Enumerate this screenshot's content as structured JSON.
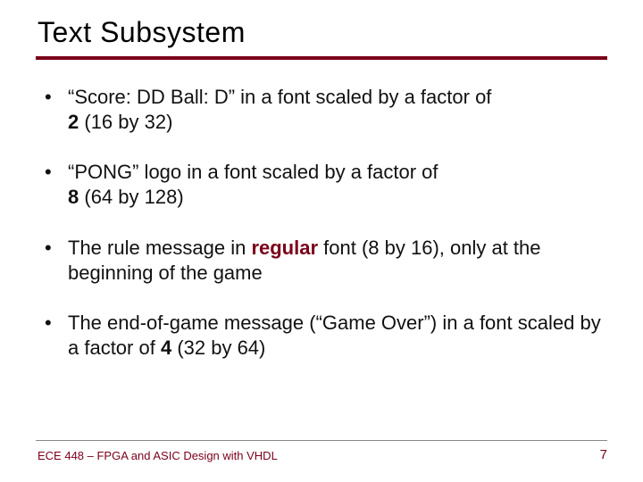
{
  "title": "Text Subsystem",
  "bullets": [
    {
      "pre": "“Score: DD  Ball:  D” in a font scaled by a factor of ",
      "strong": "2",
      "post": " (16 by 32)"
    },
    {
      "pre": "“PONG” logo in a font scaled by a factor of ",
      "strong": "8",
      "post": " (64 by 128)"
    },
    {
      "pre": "The rule message in ",
      "strong_maroon": "regular",
      "post": " font (8 by 16), only at the beginning of the game"
    },
    {
      "pre": "The end-of-game message (“Game Over”) in a font scaled by a factor of ",
      "strong": "4",
      "post": " (32 by 64)"
    }
  ],
  "footer": "ECE 448 – FPGA and ASIC Design with VHDL",
  "page": "7"
}
